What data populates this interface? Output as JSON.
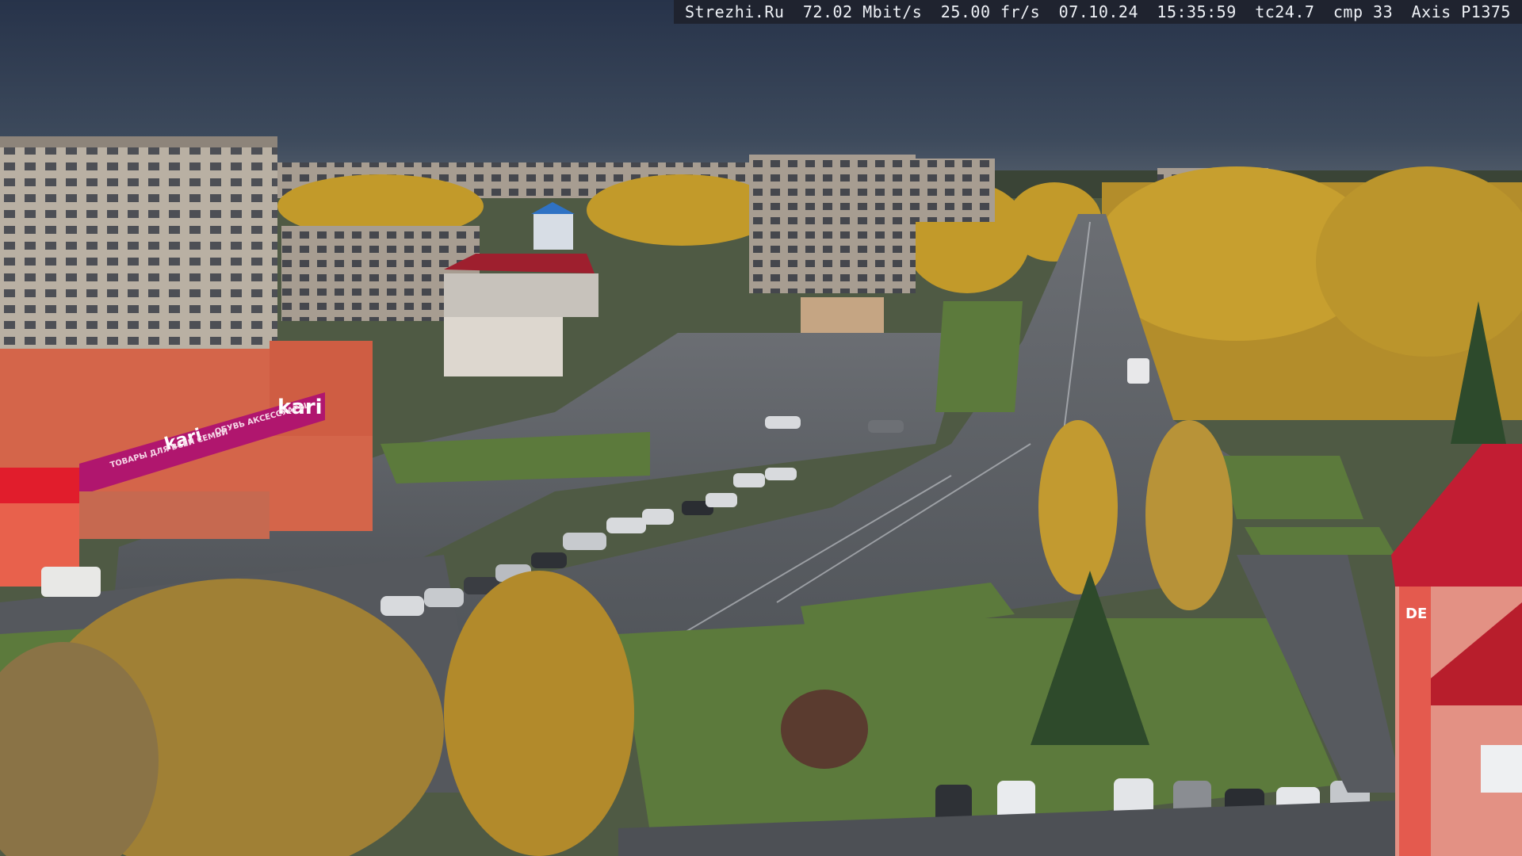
{
  "osd": {
    "site": "Strezhi.Ru",
    "bitrate": "72.02 Mbit/s",
    "fps": "25.00 fr/s",
    "date": "07.10.24",
    "time": "15:35:59",
    "tc": "tc24.7",
    "cmp": "cmp 33",
    "camera": "Axis P1375"
  },
  "signs": {
    "kari_main": "kari",
    "kari_banner": "kari",
    "kari_small_left": "kari",
    "banner_left": "ТОВАРЫ ДЛЯ ВСЕЙ СЕМЬИ",
    "banner_right": "ОБУВЬ АКСЕССУАРЫ",
    "side_building": "DE"
  },
  "colors": {
    "sky_top": "#2d3a4d",
    "sky_bottom": "#4d5a6b",
    "road": "#5a5d63",
    "grass": "#56743a",
    "autumn_birch": "#c9a02c",
    "kari_pink": "#b0166e",
    "storefront": "#d9684a",
    "red_roof": "#b81e2c"
  }
}
